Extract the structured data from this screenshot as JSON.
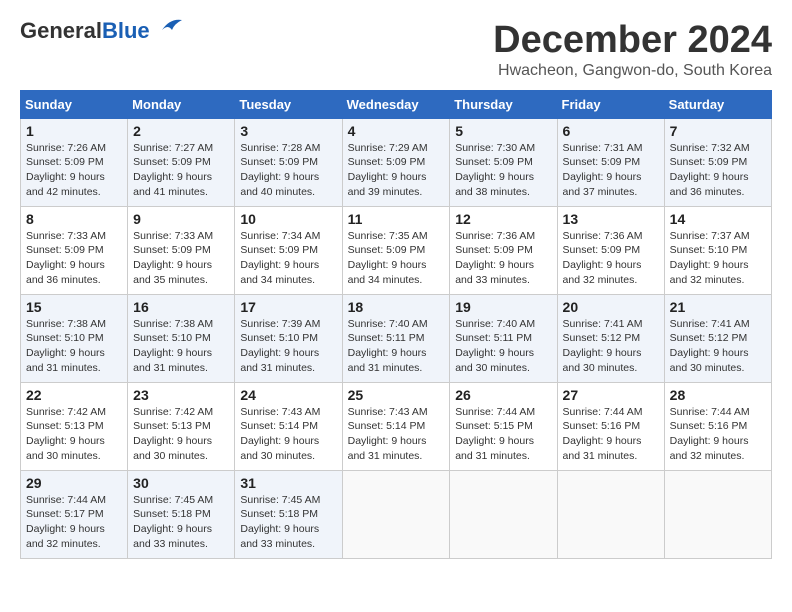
{
  "header": {
    "logo_general": "General",
    "logo_blue": "Blue",
    "month_title": "December 2024",
    "location": "Hwacheon, Gangwon-do, South Korea"
  },
  "days_of_week": [
    "Sunday",
    "Monday",
    "Tuesday",
    "Wednesday",
    "Thursday",
    "Friday",
    "Saturday"
  ],
  "weeks": [
    [
      {
        "day": "1",
        "sunrise": "7:26 AM",
        "sunset": "5:09 PM",
        "daylight": "9 hours and 42 minutes."
      },
      {
        "day": "2",
        "sunrise": "7:27 AM",
        "sunset": "5:09 PM",
        "daylight": "9 hours and 41 minutes."
      },
      {
        "day": "3",
        "sunrise": "7:28 AM",
        "sunset": "5:09 PM",
        "daylight": "9 hours and 40 minutes."
      },
      {
        "day": "4",
        "sunrise": "7:29 AM",
        "sunset": "5:09 PM",
        "daylight": "9 hours and 39 minutes."
      },
      {
        "day": "5",
        "sunrise": "7:30 AM",
        "sunset": "5:09 PM",
        "daylight": "9 hours and 38 minutes."
      },
      {
        "day": "6",
        "sunrise": "7:31 AM",
        "sunset": "5:09 PM",
        "daylight": "9 hours and 37 minutes."
      },
      {
        "day": "7",
        "sunrise": "7:32 AM",
        "sunset": "5:09 PM",
        "daylight": "9 hours and 36 minutes."
      }
    ],
    [
      {
        "day": "8",
        "sunrise": "7:33 AM",
        "sunset": "5:09 PM",
        "daylight": "9 hours and 36 minutes."
      },
      {
        "day": "9",
        "sunrise": "7:33 AM",
        "sunset": "5:09 PM",
        "daylight": "9 hours and 35 minutes."
      },
      {
        "day": "10",
        "sunrise": "7:34 AM",
        "sunset": "5:09 PM",
        "daylight": "9 hours and 34 minutes."
      },
      {
        "day": "11",
        "sunrise": "7:35 AM",
        "sunset": "5:09 PM",
        "daylight": "9 hours and 34 minutes."
      },
      {
        "day": "12",
        "sunrise": "7:36 AM",
        "sunset": "5:09 PM",
        "daylight": "9 hours and 33 minutes."
      },
      {
        "day": "13",
        "sunrise": "7:36 AM",
        "sunset": "5:09 PM",
        "daylight": "9 hours and 32 minutes."
      },
      {
        "day": "14",
        "sunrise": "7:37 AM",
        "sunset": "5:10 PM",
        "daylight": "9 hours and 32 minutes."
      }
    ],
    [
      {
        "day": "15",
        "sunrise": "7:38 AM",
        "sunset": "5:10 PM",
        "daylight": "9 hours and 31 minutes."
      },
      {
        "day": "16",
        "sunrise": "7:38 AM",
        "sunset": "5:10 PM",
        "daylight": "9 hours and 31 minutes."
      },
      {
        "day": "17",
        "sunrise": "7:39 AM",
        "sunset": "5:10 PM",
        "daylight": "9 hours and 31 minutes."
      },
      {
        "day": "18",
        "sunrise": "7:40 AM",
        "sunset": "5:11 PM",
        "daylight": "9 hours and 31 minutes."
      },
      {
        "day": "19",
        "sunrise": "7:40 AM",
        "sunset": "5:11 PM",
        "daylight": "9 hours and 30 minutes."
      },
      {
        "day": "20",
        "sunrise": "7:41 AM",
        "sunset": "5:12 PM",
        "daylight": "9 hours and 30 minutes."
      },
      {
        "day": "21",
        "sunrise": "7:41 AM",
        "sunset": "5:12 PM",
        "daylight": "9 hours and 30 minutes."
      }
    ],
    [
      {
        "day": "22",
        "sunrise": "7:42 AM",
        "sunset": "5:13 PM",
        "daylight": "9 hours and 30 minutes."
      },
      {
        "day": "23",
        "sunrise": "7:42 AM",
        "sunset": "5:13 PM",
        "daylight": "9 hours and 30 minutes."
      },
      {
        "day": "24",
        "sunrise": "7:43 AM",
        "sunset": "5:14 PM",
        "daylight": "9 hours and 30 minutes."
      },
      {
        "day": "25",
        "sunrise": "7:43 AM",
        "sunset": "5:14 PM",
        "daylight": "9 hours and 31 minutes."
      },
      {
        "day": "26",
        "sunrise": "7:44 AM",
        "sunset": "5:15 PM",
        "daylight": "9 hours and 31 minutes."
      },
      {
        "day": "27",
        "sunrise": "7:44 AM",
        "sunset": "5:16 PM",
        "daylight": "9 hours and 31 minutes."
      },
      {
        "day": "28",
        "sunrise": "7:44 AM",
        "sunset": "5:16 PM",
        "daylight": "9 hours and 32 minutes."
      }
    ],
    [
      {
        "day": "29",
        "sunrise": "7:44 AM",
        "sunset": "5:17 PM",
        "daylight": "9 hours and 32 minutes."
      },
      {
        "day": "30",
        "sunrise": "7:45 AM",
        "sunset": "5:18 PM",
        "daylight": "9 hours and 33 minutes."
      },
      {
        "day": "31",
        "sunrise": "7:45 AM",
        "sunset": "5:18 PM",
        "daylight": "9 hours and 33 minutes."
      },
      null,
      null,
      null,
      null
    ]
  ]
}
